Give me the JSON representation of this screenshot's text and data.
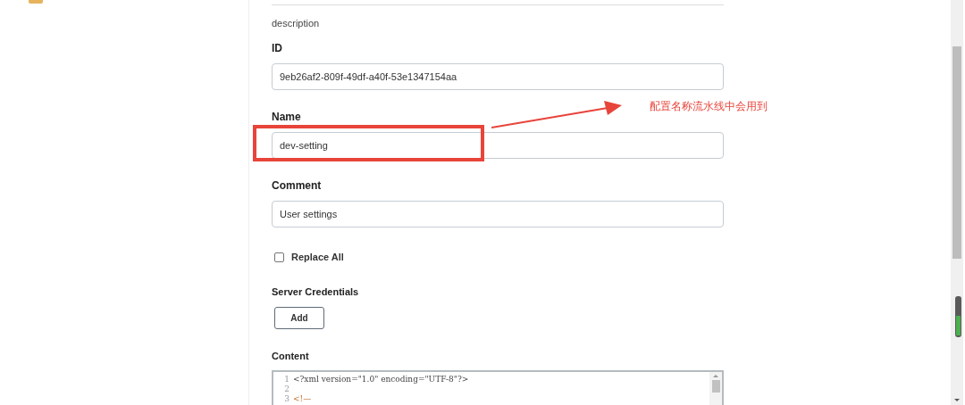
{
  "description": "description",
  "fields": [
    {
      "kind": "text",
      "label": "ID",
      "value": "9eb26af2-809f-49df-a40f-53e1347154aa"
    },
    {
      "kind": "text",
      "label": "Name",
      "value": "dev-setting"
    },
    {
      "kind": "text",
      "label": "Comment",
      "value": "User settings"
    },
    {
      "kind": "checkbox",
      "label": "Replace All",
      "checked": false
    },
    {
      "kind": "button",
      "label": "Server Credentials",
      "button": "Add"
    }
  ],
  "content": {
    "label": "Content",
    "lines": [
      {
        "number": "1",
        "kind": "declaration",
        "text": "<?xml version=\"1.0\" encoding=\"UTF-8\"?>"
      },
      {
        "number": "2",
        "kind": "blank"
      },
      {
        "number": "3",
        "kind": "comment",
        "text": "<!—"
      }
    ]
  },
  "annotation": {
    "text": "配置名称流水线中会用到"
  }
}
